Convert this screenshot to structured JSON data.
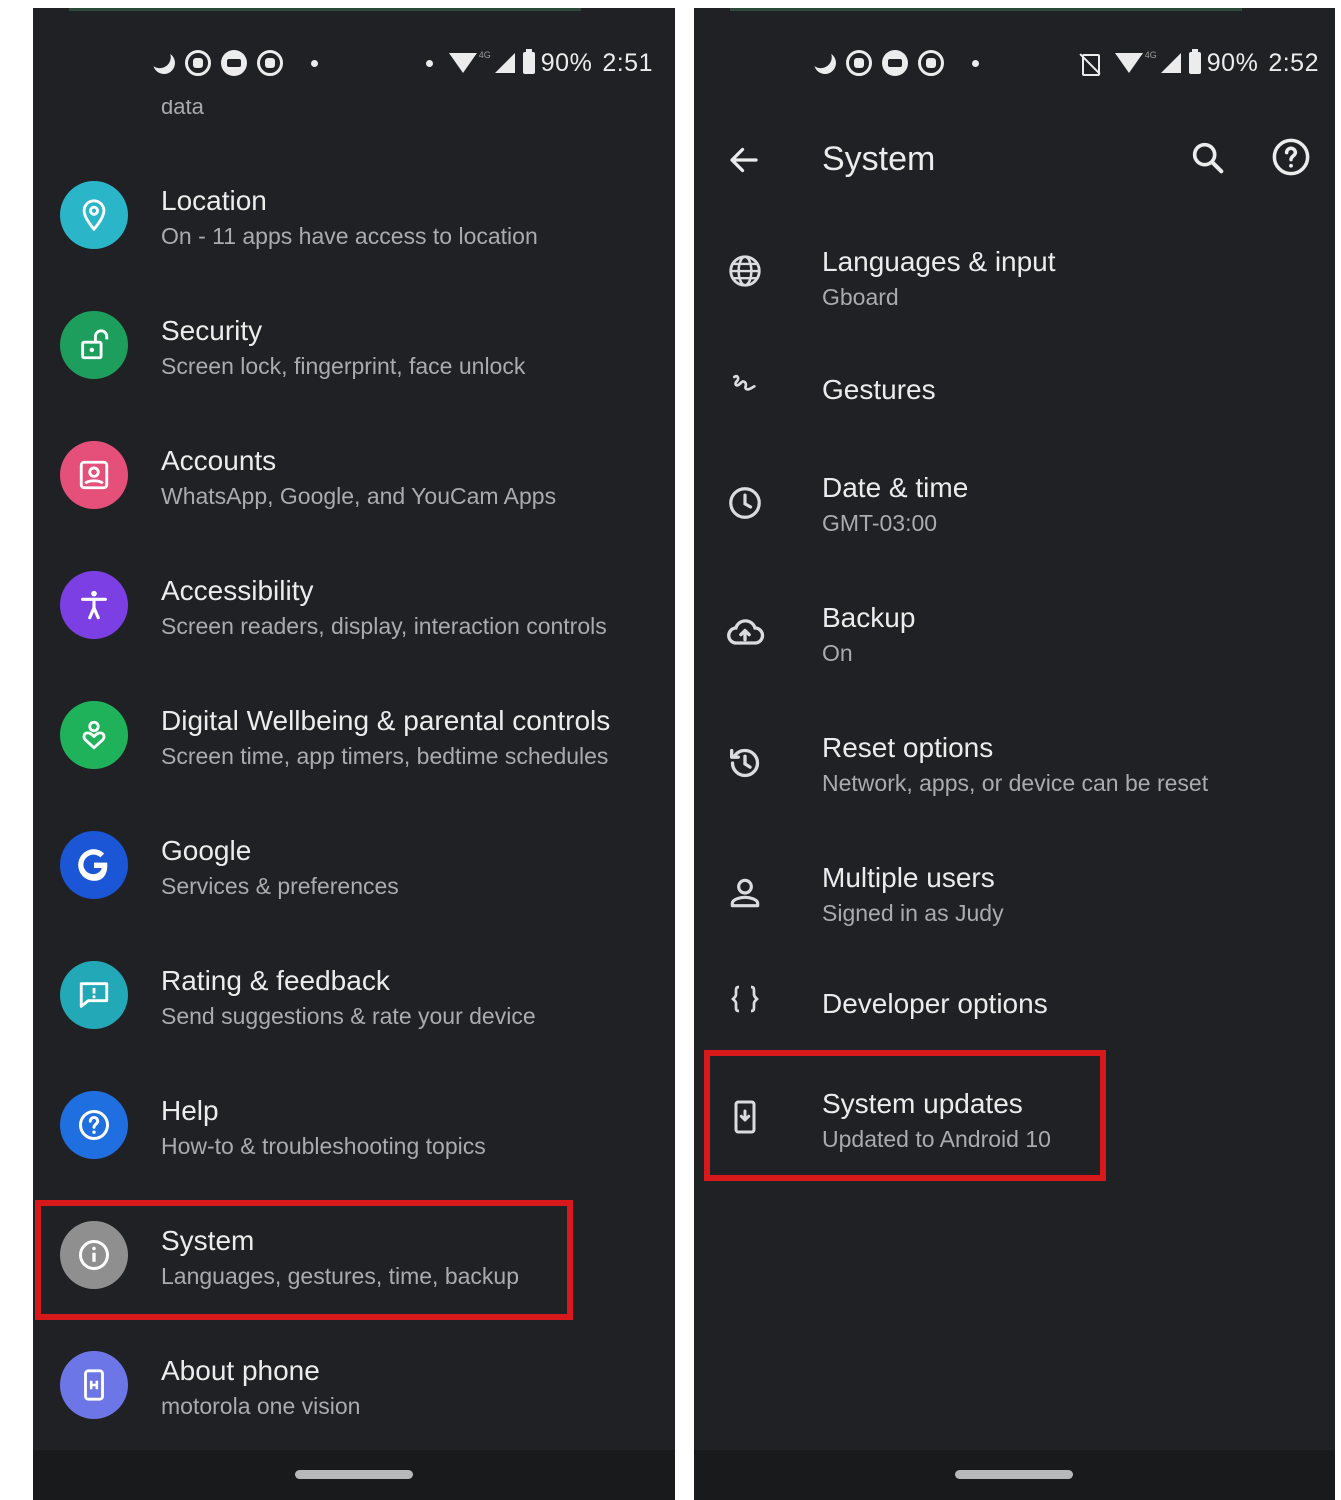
{
  "left_screen": {
    "status": {
      "battery": "90%",
      "time": "2:51"
    },
    "scrolled_text": "data",
    "items": [
      {
        "title": "Location",
        "subtitle": "On - 11 apps have access to location",
        "icon": "location-pin-icon",
        "color": "#2bb5c9"
      },
      {
        "title": "Security",
        "subtitle": "Screen lock, fingerprint, face unlock",
        "icon": "unlock-icon",
        "color": "#1e9e5c"
      },
      {
        "title": "Accounts",
        "subtitle": "WhatsApp, Google, and YouCam Apps",
        "icon": "account-box-icon",
        "color": "#e5507a"
      },
      {
        "title": "Accessibility",
        "subtitle": "Screen readers, display, interaction controls",
        "icon": "accessibility-icon",
        "color": "#7b3fe4"
      },
      {
        "title": "Digital Wellbeing & parental controls",
        "subtitle": "Screen time, app timers, bedtime schedules",
        "icon": "wellbeing-heart-icon",
        "color": "#1fb25b"
      },
      {
        "title": "Google",
        "subtitle": "Services & preferences",
        "icon": "google-g-icon",
        "color": "#1a56d6"
      },
      {
        "title": "Rating & feedback",
        "subtitle": "Send suggestions & rate your device",
        "icon": "feedback-icon",
        "color": "#22a8b6"
      },
      {
        "title": "Help",
        "subtitle": "How-to & troubleshooting topics",
        "icon": "help-circle-icon",
        "color": "#1f6fe0"
      },
      {
        "title": "System",
        "subtitle": "Languages, gestures, time, backup",
        "icon": "info-icon",
        "color": "#8f8f8f"
      },
      {
        "title": "About phone",
        "subtitle": "motorola one vision",
        "icon": "phone-icon",
        "color": "#6d76e6"
      }
    ]
  },
  "right_screen": {
    "status": {
      "battery": "90%",
      "time": "2:52"
    },
    "title": "System",
    "items": [
      {
        "title": "Languages & input",
        "subtitle": "Gboard",
        "icon": "globe-icon"
      },
      {
        "title": "Gestures",
        "subtitle": "",
        "icon": "gesture-icon"
      },
      {
        "title": "Date & time",
        "subtitle": "GMT-03:00",
        "icon": "clock-icon"
      },
      {
        "title": "Backup",
        "subtitle": "On",
        "icon": "cloud-upload-icon"
      },
      {
        "title": "Reset options",
        "subtitle": "Network, apps, or device can be reset",
        "icon": "history-icon"
      },
      {
        "title": "Multiple users",
        "subtitle": "Signed in as Judy",
        "icon": "person-icon"
      },
      {
        "title": "Developer options",
        "subtitle": "",
        "icon": "braces-icon"
      },
      {
        "title": "System updates",
        "subtitle": "Updated to Android 10",
        "icon": "system-update-icon"
      }
    ]
  },
  "colors": {
    "background": "#202124",
    "highlight": "#d7191c"
  }
}
